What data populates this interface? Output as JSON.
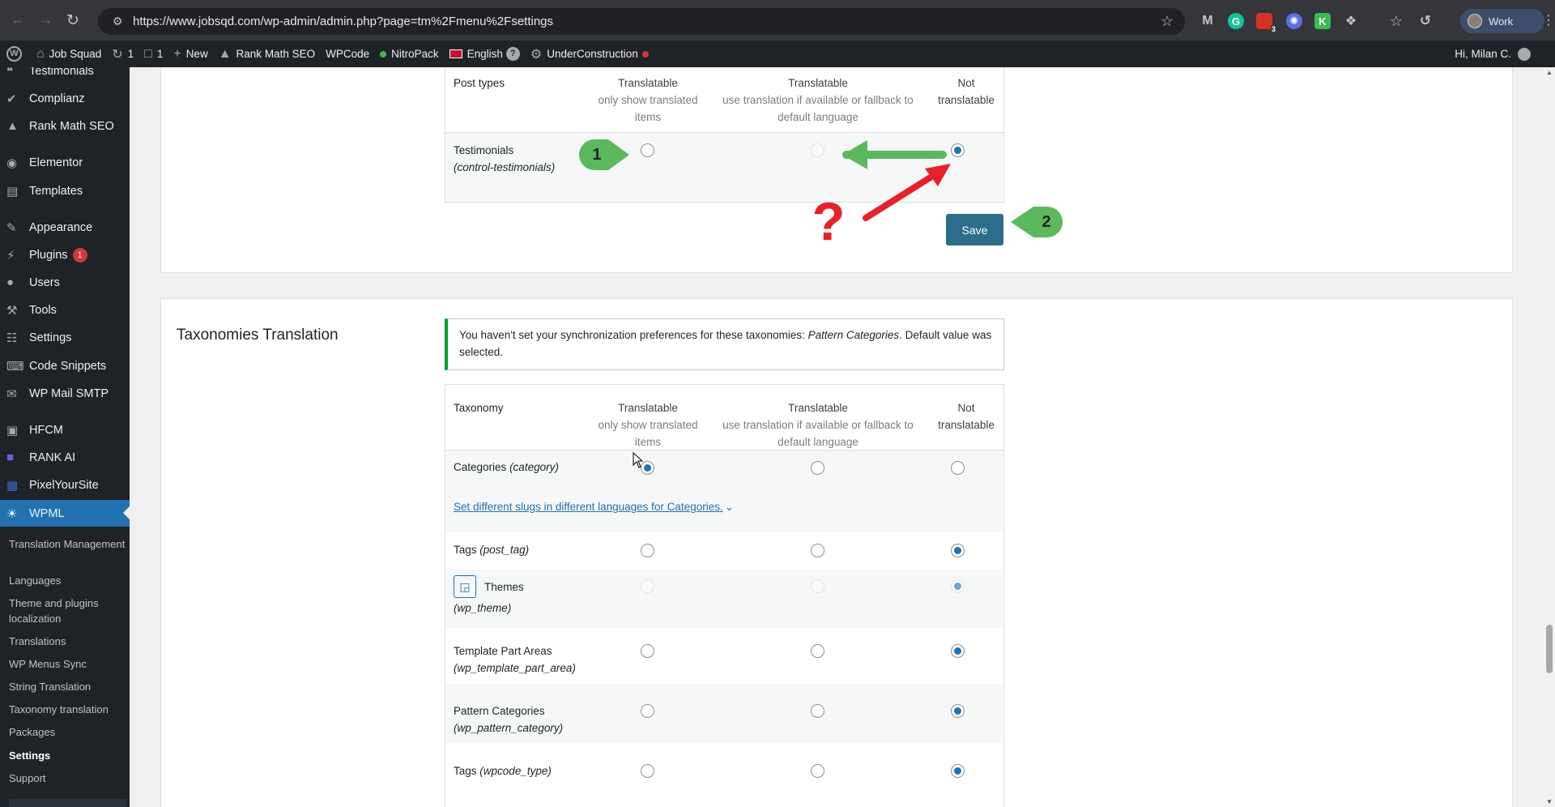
{
  "browser": {
    "url": "https://www.jobsqd.com/wp-admin/admin.php?page=tm%2Fmenu%2Fsettings",
    "profile_label": "Work",
    "ext_badge": "3"
  },
  "adminbar": {
    "site": "Job Squad",
    "updates": "1",
    "comments": "1",
    "new": "New",
    "rankmath": "Rank Math SEO",
    "wpcode": "WPCode",
    "nitropack": "NitroPack",
    "language": "English",
    "language_badge": "?",
    "underconstruction": "UnderConstruction",
    "howdy": "Hi, Milan C."
  },
  "sidebar": {
    "items": [
      {
        "label": "Testimonials",
        "icon": "quote-icon"
      },
      {
        "label": "Complianz",
        "icon": "check-icon"
      },
      {
        "label": "Rank Math SEO",
        "icon": "chart-icon"
      },
      {
        "label": "Elementor",
        "icon": "elementor-icon"
      },
      {
        "label": "Templates",
        "icon": "folder-icon"
      },
      {
        "label": "Appearance",
        "icon": "brush-icon"
      },
      {
        "label": "Plugins",
        "icon": "plug-icon",
        "badge": "1"
      },
      {
        "label": "Users",
        "icon": "user-icon"
      },
      {
        "label": "Tools",
        "icon": "wrench-icon"
      },
      {
        "label": "Settings",
        "icon": "sliders-icon"
      },
      {
        "label": "Code Snippets",
        "icon": "code-icon"
      },
      {
        "label": "WP Mail SMTP",
        "icon": "mail-icon"
      },
      {
        "label": "HFCM",
        "icon": "robot-icon"
      },
      {
        "label": "RANK AI",
        "icon": "rank-ai-icon"
      },
      {
        "label": "PixelYourSite",
        "icon": "grid-icon"
      },
      {
        "label": "WPML",
        "icon": "wpml-icon"
      }
    ],
    "submenu": [
      "Translation Management",
      "Languages",
      "Theme and plugins localization",
      "Translations",
      "WP Menus Sync",
      "String Translation",
      "Taxonomy translation",
      "Packages",
      "Settings",
      "Support"
    ]
  },
  "post_types": {
    "col_label": "Post types",
    "col1_title": "Translatable",
    "col1_sub": "only show translated items",
    "col2_title": "Translatable",
    "col2_sub": "use translation if available or fallback to default language",
    "col3_title": "Not translatable",
    "row_label": "Testimonials",
    "row_slug": "(control-testimonials)",
    "selected": 3,
    "save": "Save"
  },
  "annotations": {
    "callout_1": "1",
    "callout_2": "2",
    "question": "?",
    "green_color": "#5cb85c",
    "red_color": "#e8202a"
  },
  "taxonomies": {
    "section_title": "Taxonomies Translation",
    "notice_before": "You haven't set your synchronization preferences for these taxonomies: ",
    "notice_em": "Pattern Categories",
    "notice_after": ". Default value was selected.",
    "col_label": "Taxonomy",
    "col1_title": "Translatable",
    "col1_sub": "only show translated items",
    "col2_title": "Translatable",
    "col2_sub": "use translation if available or fallback to default language",
    "col3_title": "Not translatable",
    "slug_link": "Set different slugs in different languages for Categories.",
    "rows": [
      {
        "name": "Categories",
        "slug": "(category)",
        "selected": 1
      },
      {
        "name": "Tags",
        "slug": "(post_tag)",
        "selected": 3
      },
      {
        "name": "Themes",
        "slug": "(wp_theme)",
        "selected": 3,
        "locked": true
      },
      {
        "name": "Template Part Areas",
        "slug": "(wp_template_part_area)",
        "selected": 3
      },
      {
        "name": "Pattern Categories",
        "slug": "(wp_pattern_category)",
        "selected": 3
      },
      {
        "name": "Tags",
        "slug": "(wpcode_type)",
        "selected": 3
      }
    ]
  }
}
